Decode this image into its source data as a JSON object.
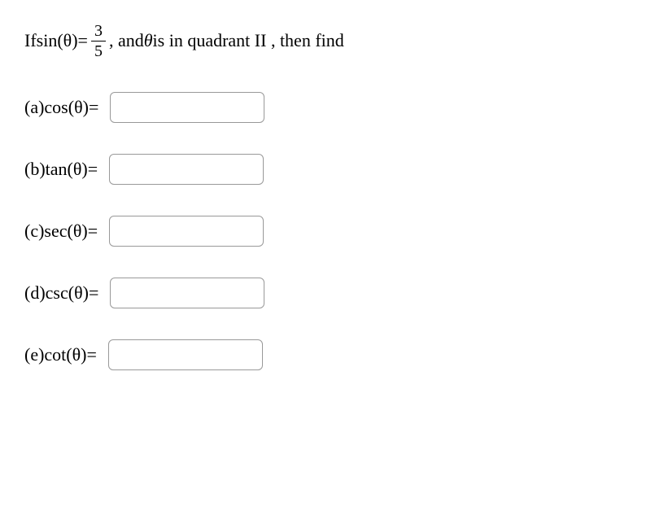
{
  "problem": {
    "prefix": "If ",
    "sinExpr": "sin(θ)",
    "equals": " = ",
    "frac_num": "3",
    "frac_den": "5",
    "middle": ", and ",
    "thetaVar": "θ",
    "quadrantText": " is in quadrant II ,  then find"
  },
  "parts": [
    {
      "label": "(a) ",
      "func": "cos(θ)",
      "eq": " = "
    },
    {
      "label": "(b) ",
      "func": "tan(θ)",
      "eq": " = "
    },
    {
      "label": "(c) ",
      "func": "sec(θ)",
      "eq": " = "
    },
    {
      "label": "(d) ",
      "func": "csc(θ)",
      "eq": " = "
    },
    {
      "label": "(e) ",
      "func": "cot(θ)",
      "eq": " = "
    }
  ]
}
